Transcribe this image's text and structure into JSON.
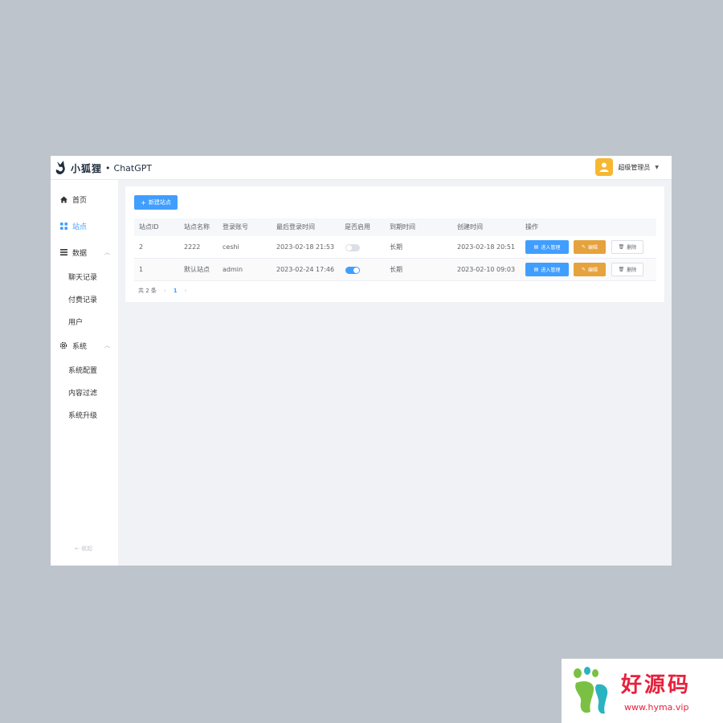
{
  "header": {
    "logo_cn": "小狐狸",
    "logo_dot": "•",
    "logo_en": "ChatGPT",
    "user_name": "超级管理员"
  },
  "sidebar": {
    "items": [
      {
        "label": "首页",
        "icon": "home-icon"
      },
      {
        "label": "站点",
        "icon": "grid-icon",
        "active": true
      },
      {
        "label": "数据",
        "icon": "list-icon",
        "expanded": true,
        "children": [
          "聊天记录",
          "付费记录",
          "用户"
        ]
      },
      {
        "label": "系统",
        "icon": "gear-icon",
        "expanded": true,
        "children": [
          "系统配置",
          "内容过滤",
          "系统升级"
        ]
      }
    ],
    "collapse_label": "收起"
  },
  "toolbar": {
    "new_button": "新建站点"
  },
  "table": {
    "columns": [
      "站点ID",
      "站点名称",
      "登录账号",
      "最后登录时间",
      "是否启用",
      "到期时间",
      "创建时间",
      "操作"
    ],
    "rows": [
      {
        "id": "2",
        "name": "2222",
        "account": "ceshi",
        "last_login": "2023-02-18 21:53",
        "enabled": false,
        "expire": "长期",
        "created": "2023-02-18 20:51"
      },
      {
        "id": "1",
        "name": "默认站点",
        "account": "admin",
        "last_login": "2023-02-24 17:46",
        "enabled": true,
        "expire": "长期",
        "created": "2023-02-10 09:03"
      }
    ],
    "actions": {
      "manage": "进入管理",
      "edit": "编辑",
      "delete": "删除"
    }
  },
  "pagination": {
    "total": "共 2 条",
    "current_page": "1"
  },
  "watermark": {
    "title": "好源码",
    "url": "www.hyma.vip"
  },
  "colors": {
    "primary": "#409eff",
    "warning": "#e6a23c",
    "avatar": "#f7b731",
    "watermark": "#e6213d"
  }
}
